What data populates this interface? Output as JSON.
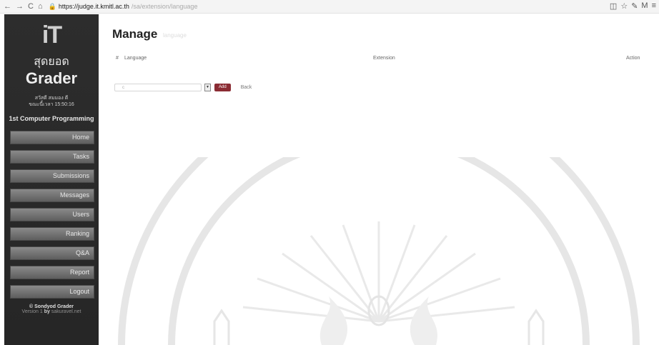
{
  "browser": {
    "url_domain": "https://judge.it.kmitl.ac.th",
    "url_path": "/sa/extension/language",
    "nav_back": "←",
    "nav_forward": "→",
    "nav_reload": "C",
    "nav_home": "⌂"
  },
  "sidebar": {
    "logo_text": "iT",
    "brand_thai": "สุดยอด",
    "brand": "Grader",
    "status_line1": "สวัสดี สมมอง ดี",
    "status_line2": "ขณะนี้เวลา 15:50:16",
    "course": "1st Computer Programming",
    "menu": [
      {
        "label": "Home"
      },
      {
        "label": "Tasks"
      },
      {
        "label": "Submissions"
      },
      {
        "label": "Messages"
      },
      {
        "label": "Users"
      },
      {
        "label": "Ranking"
      },
      {
        "label": "Q&A"
      },
      {
        "label": "Report"
      },
      {
        "label": "Logout"
      }
    ],
    "footer_line1": "© Sondyod Grader",
    "footer_line2_prefix": "Version 1",
    "footer_line2_by": "by",
    "footer_line2_author": "sakuravel.net"
  },
  "main": {
    "title": "Manage",
    "subtitle": "language",
    "table": {
      "col_num": "#",
      "col_language": "Language",
      "col_extension": "Extension",
      "col_action": "Action"
    },
    "extension_value": "c",
    "add_label": "Add",
    "back_label": "Back"
  }
}
